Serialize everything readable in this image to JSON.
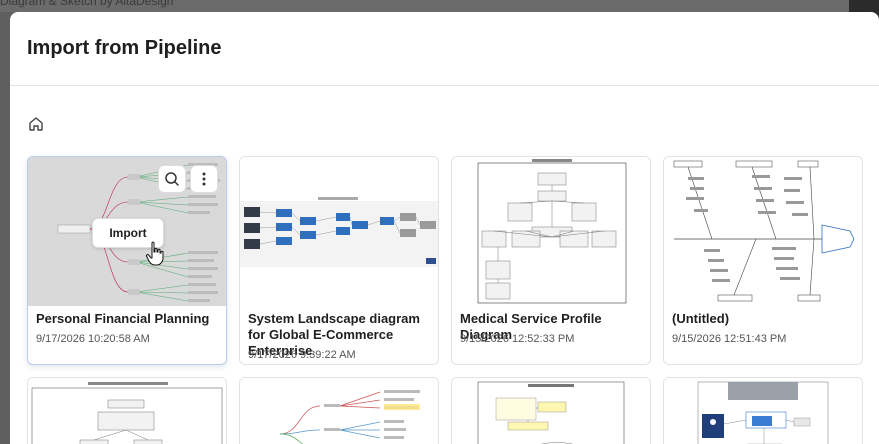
{
  "backdrop_text": "Diagram & Sketch by AltaDesign",
  "modal": {
    "title": "Import from Pipeline"
  },
  "breadcrumb": {
    "home_icon": "home-icon"
  },
  "cards": [
    {
      "title": "Personal Financial Planning",
      "date": "9/17/2026 10:20:58 AM",
      "hovered": true
    },
    {
      "title": "System Landscape diagram for Global E-Commerce Enterprise",
      "date": "9/17/2026 9:39:22 AM"
    },
    {
      "title": "Medical Service Profile Diagram",
      "date": "9/15/2026 12:52:33 PM"
    },
    {
      "title": "(Untitled)",
      "date": "9/15/2026 12:51:43 PM"
    }
  ],
  "card_actions": {
    "import_label": "Import",
    "search_icon": "search-icon",
    "more_icon": "more-vertical-icon"
  }
}
